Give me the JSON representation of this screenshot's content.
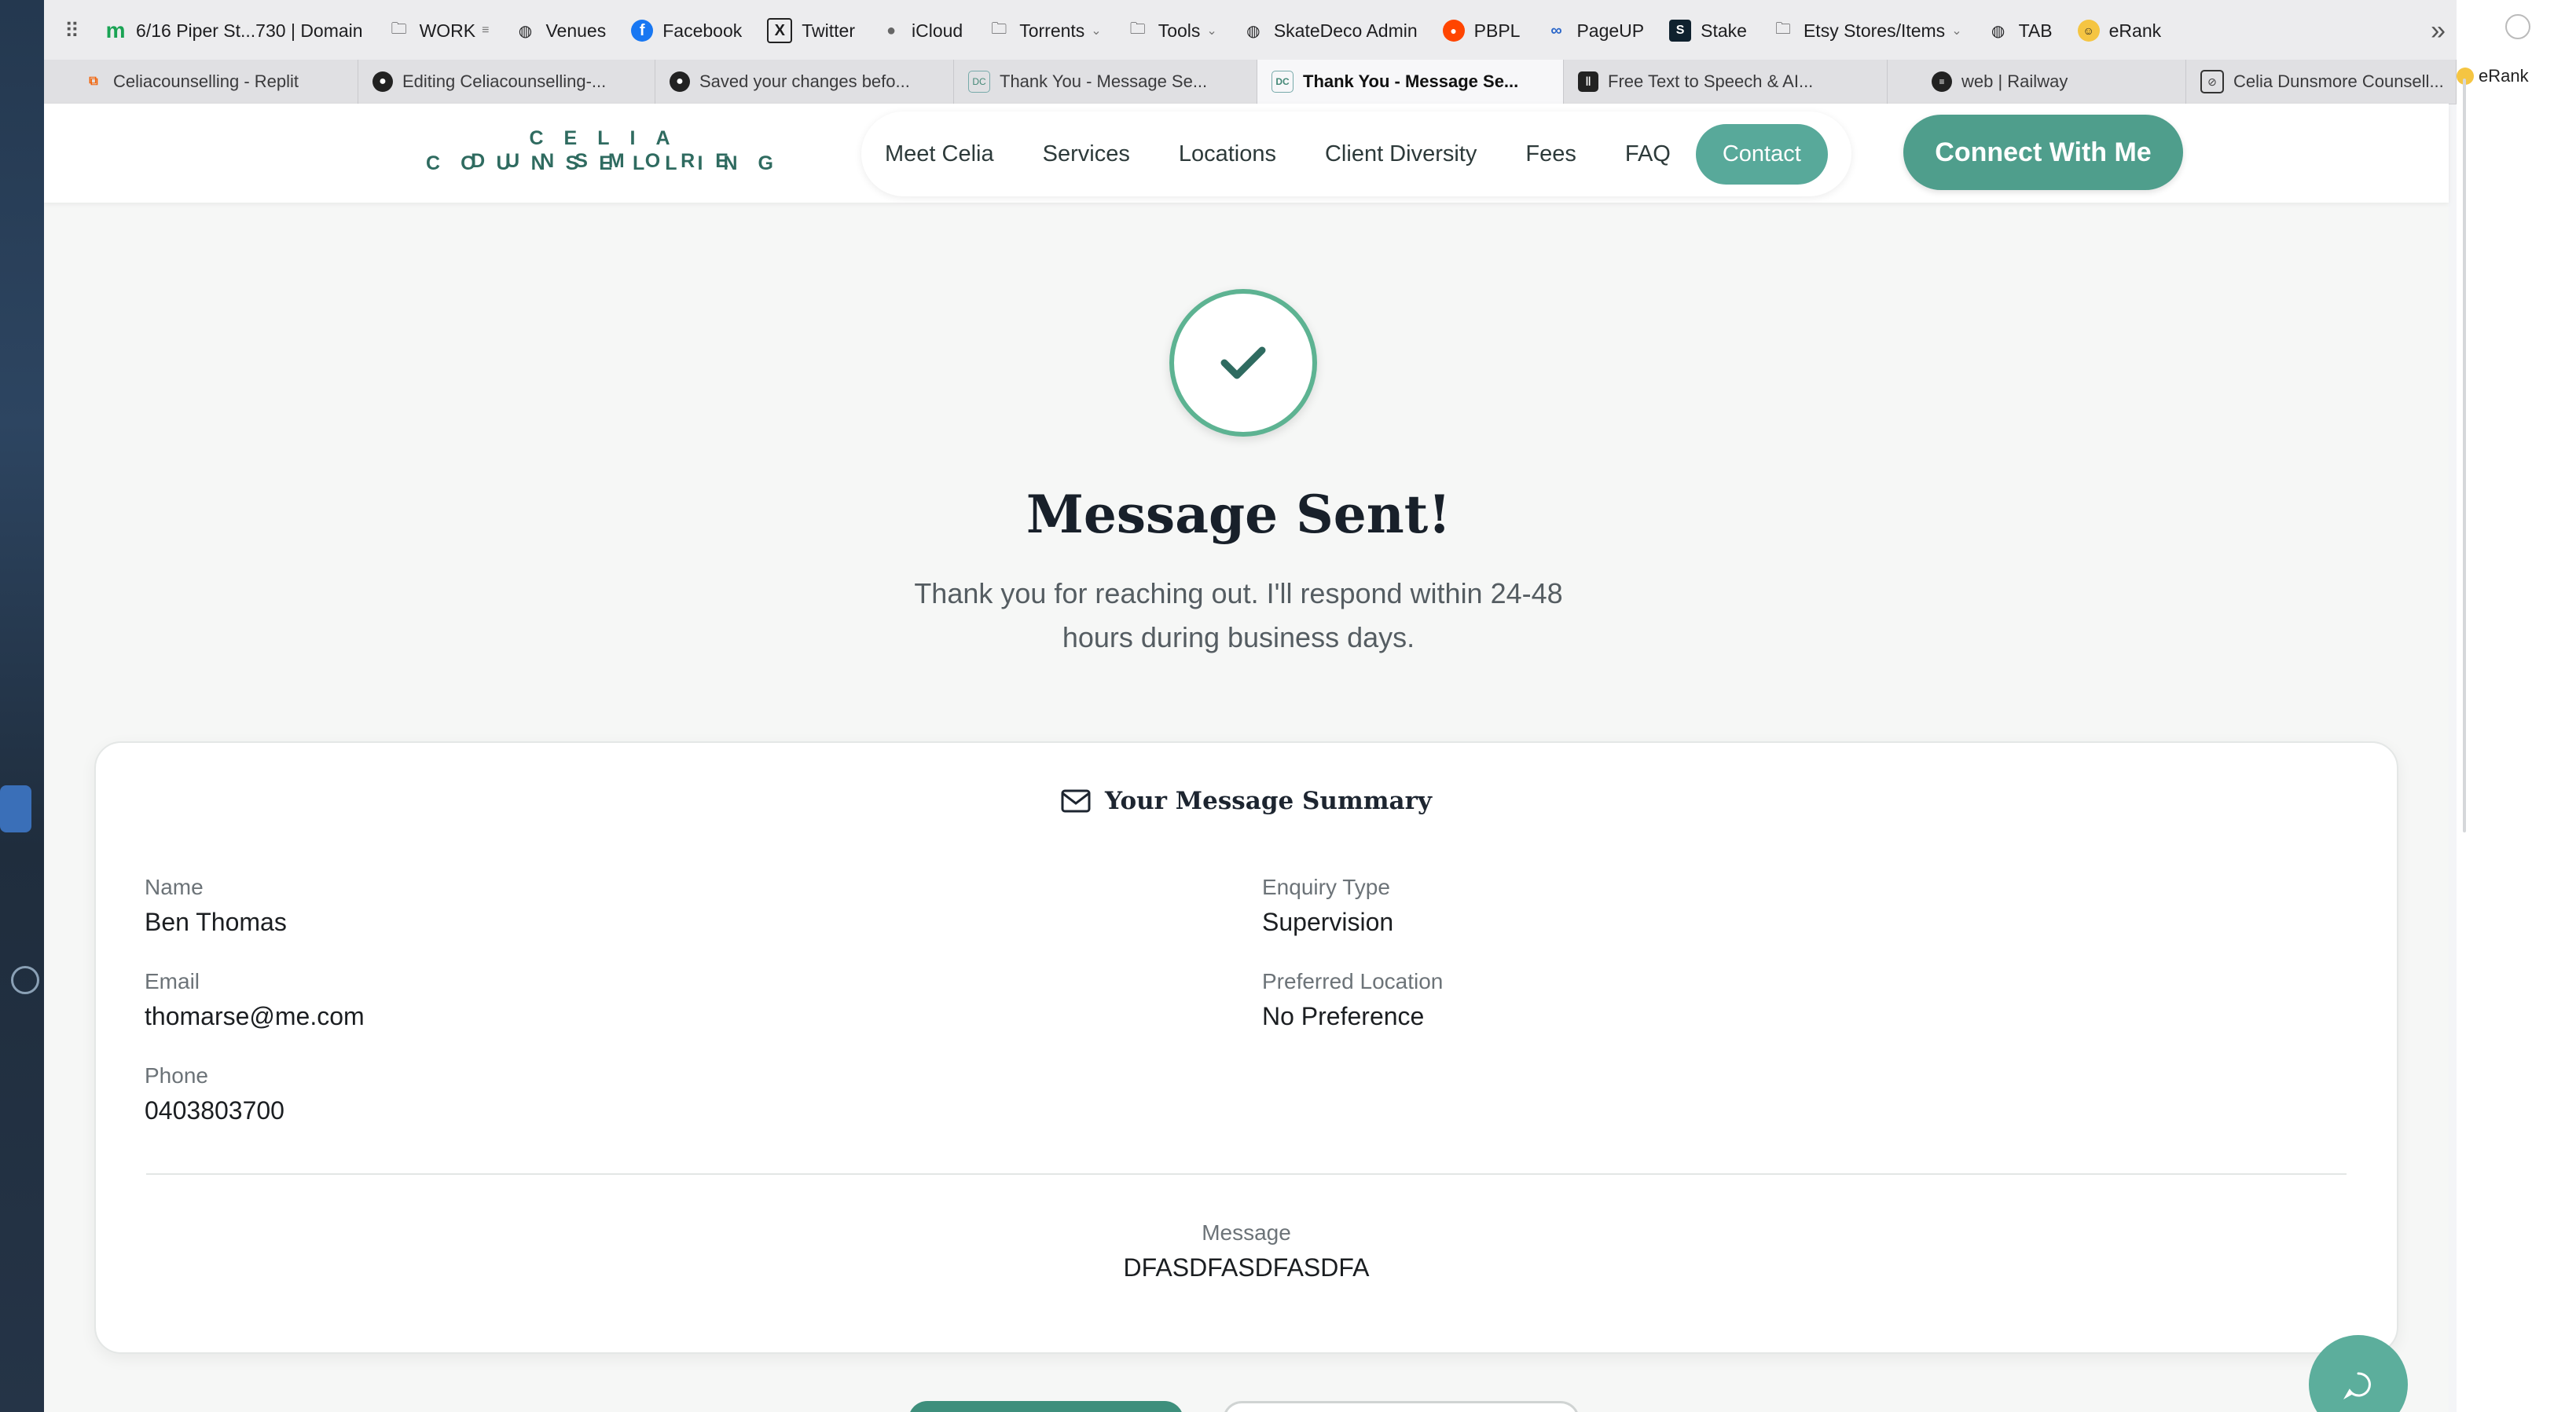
{
  "bookmarks": [
    {
      "label": "6/16 Piper St...730 | Domain",
      "icon": "domain-m-icon"
    },
    {
      "label": "WORK",
      "icon": "folder-icon"
    },
    {
      "label": "Venues",
      "icon": "globe-icon"
    },
    {
      "label": "Facebook",
      "icon": "facebook-icon"
    },
    {
      "label": "Twitter",
      "icon": "x-icon"
    },
    {
      "label": "iCloud",
      "icon": "apple-icon"
    },
    {
      "label": "Torrents",
      "icon": "folder-icon"
    },
    {
      "label": "Tools",
      "icon": "folder-icon"
    },
    {
      "label": "SkateDeco Admin",
      "icon": "globe-icon"
    },
    {
      "label": "PBPL",
      "icon": "reddit-icon"
    },
    {
      "label": "PageUP",
      "icon": "pageup-icon"
    },
    {
      "label": "Stake",
      "icon": "stake-icon"
    },
    {
      "label": "Etsy Stores/Items",
      "icon": "folder-icon"
    },
    {
      "label": "TAB",
      "icon": "globe-icon"
    },
    {
      "label": "eRank",
      "icon": "smiley-icon"
    }
  ],
  "tabs": [
    {
      "label": "Celiacounselling - Replit",
      "active": false
    },
    {
      "label": "Editing Celiacounselling-...",
      "active": false
    },
    {
      "label": "Saved your changes befo...",
      "active": false
    },
    {
      "label": "Thank You - Message Se...",
      "active": false
    },
    {
      "label": "Thank You - Message Se...",
      "active": true
    },
    {
      "label": "Free Text to Speech & AI...",
      "active": false
    },
    {
      "label": "web | Railway",
      "active": false
    },
    {
      "label": "Celia Dunsmore Counsell...",
      "active": false
    }
  ],
  "right_strip_label": "eRank",
  "logo": {
    "line1": "CELIA DUNSMORE",
    "line2": "COUNSELLING"
  },
  "nav": {
    "items": [
      "Meet Celia",
      "Services",
      "Locations",
      "Client Diversity",
      "Fees",
      "FAQ"
    ],
    "contact": "Contact",
    "cta": "Connect With Me"
  },
  "confirmation": {
    "title": "Message Sent!",
    "subtitle_line1": "Thank you for reaching out. I'll respond within 24-48",
    "subtitle_line2": "hours during business days."
  },
  "summary": {
    "title": "Your Message Summary",
    "name_label": "Name",
    "name": "Ben Thomas",
    "email_label": "Email",
    "email": "thomarse@me.com",
    "phone_label": "Phone",
    "phone": "0403803700",
    "enquiry_label": "Enquiry Type",
    "enquiry": "Supervision",
    "location_label": "Preferred Location",
    "location": "No Preference",
    "message_label": "Message",
    "message": "DFASDFASDFASDFA"
  },
  "colors": {
    "brand": "#4f9e8c",
    "brand_light": "#58a99a",
    "check": "#5db392"
  }
}
